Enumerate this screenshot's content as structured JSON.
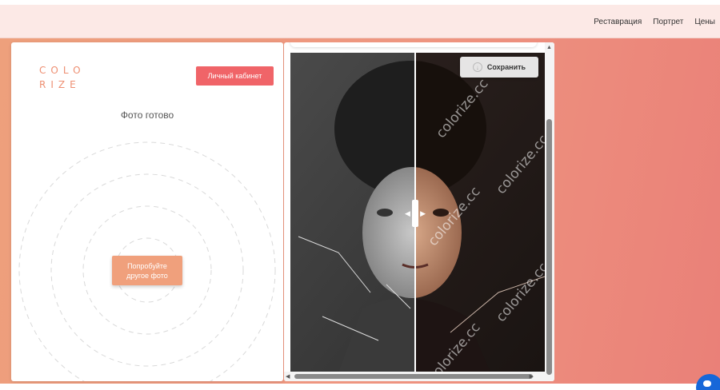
{
  "nav": {
    "links": [
      "Реставрация",
      "Портрет",
      "Цены"
    ]
  },
  "left_panel": {
    "logo_line1": "COLO",
    "logo_line2": "RIZE",
    "cabinet_button": "Личный кабинет",
    "status_title": "Фото готово",
    "try_button_line1": "Попробуйте",
    "try_button_line2": "другое фото"
  },
  "viewer": {
    "save_button": "Сохранить",
    "watermark": "colorize.cc"
  },
  "colors": {
    "accent_red": "#f06468",
    "accent_peach": "#f0a07c",
    "brand_text": "#ee8f72",
    "chat_blue": "#1667d9"
  },
  "icons": [
    "save-icon",
    "chat-icon",
    "scroll-up-arrow-icon",
    "scroll-left-arrow-icon",
    "scroll-right-arrow-icon"
  ]
}
